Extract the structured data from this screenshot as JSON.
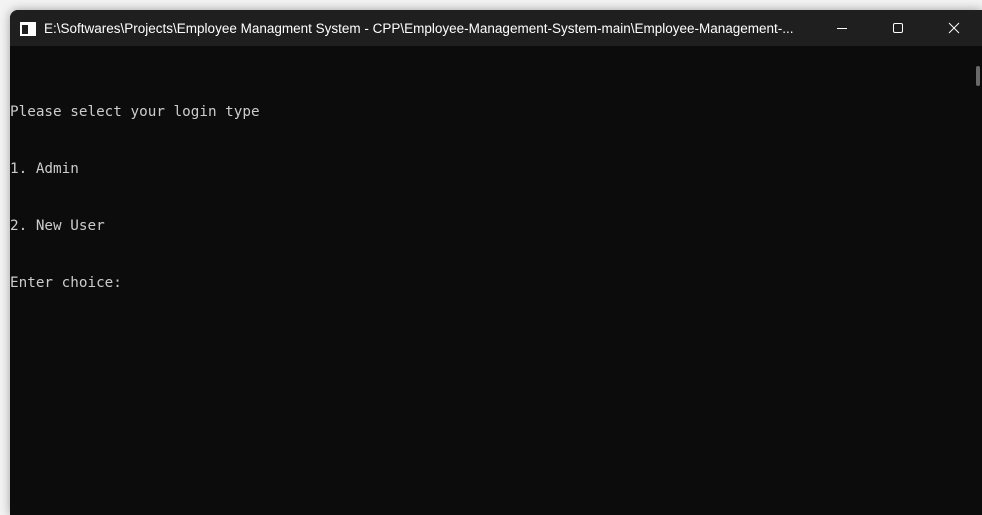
{
  "window": {
    "title": "E:\\Softwares\\Projects\\Employee Managment System - CPP\\Employee-Management-System-main\\Employee-Management-...",
    "app_icon": "console-app-icon",
    "controls": {
      "minimize_icon": "minimize-icon",
      "maximize_icon": "maximize-icon",
      "close_icon": "close-icon"
    }
  },
  "console": {
    "lines": [
      "Please select your login type",
      "1. Admin",
      "2. New User",
      "Enter choice:"
    ],
    "text_color": "#cccccc",
    "background": "#0c0c0c"
  }
}
